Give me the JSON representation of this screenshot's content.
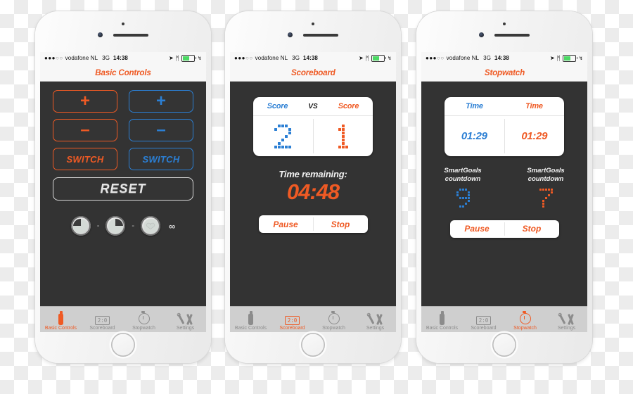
{
  "statusbar": {
    "signal_filled": "●●●",
    "signal_empty": "○○",
    "carrier": "vodafone NL",
    "network": "3G",
    "time": "14:38",
    "location_icon": "➤",
    "bluetooth_icon": "ᛗ",
    "charging_icon": "↯",
    "battery_percent": 52
  },
  "colors": {
    "orange": "#ef5a24",
    "blue": "#2b7fd4",
    "screen_bg": "#333333",
    "chrome": "#f7f7f7",
    "tabbar": "#cfcfcf"
  },
  "tabs": [
    {
      "label": "Basic Controls",
      "icon": "bottle-icon"
    },
    {
      "label": "Scoreboard",
      "icon": "scorebox-icon",
      "icon_text": "2:0"
    },
    {
      "label": "Stopwatch",
      "icon": "stopwatch-icon"
    },
    {
      "label": "Settings",
      "icon": "tools-icon"
    }
  ],
  "phones": [
    {
      "title": "Basic Controls",
      "active_tab": 0,
      "controls": {
        "plus_left": "+",
        "plus_right": "+",
        "minus_left": "–",
        "minus_right": "–",
        "switch_left": "SWITCH",
        "switch_right": "SWITCH",
        "reset": "RESET"
      },
      "gauges": {
        "separator": "-",
        "infinity": "∞",
        "items": [
          "clock-gauge",
          "clock-gauge",
          "heart-gauge"
        ]
      }
    },
    {
      "title": "Scoreboard",
      "active_tab": 1,
      "score_card": {
        "left_label": "Score",
        "vs": "VS",
        "right_label": "Score",
        "left_value": "2",
        "right_value": "1"
      },
      "time_remaining_label": "Time remaining:",
      "time_remaining_value": "04:48",
      "buttons": {
        "pause": "Pause",
        "stop": "Stop"
      }
    },
    {
      "title": "Stopwatch",
      "active_tab": 2,
      "time_card": {
        "left_label": "Time",
        "right_label": "Time",
        "left_value": "01:29",
        "right_value": "01:29"
      },
      "smartgoals": {
        "left_label_line1": "SmartGoals",
        "left_label_line2": "countdown",
        "right_label_line1": "SmartGoals",
        "right_label_line2": "countdown",
        "left_value": "9",
        "right_value": "7"
      },
      "buttons": {
        "pause": "Pause",
        "stop": "Stop"
      }
    }
  ]
}
